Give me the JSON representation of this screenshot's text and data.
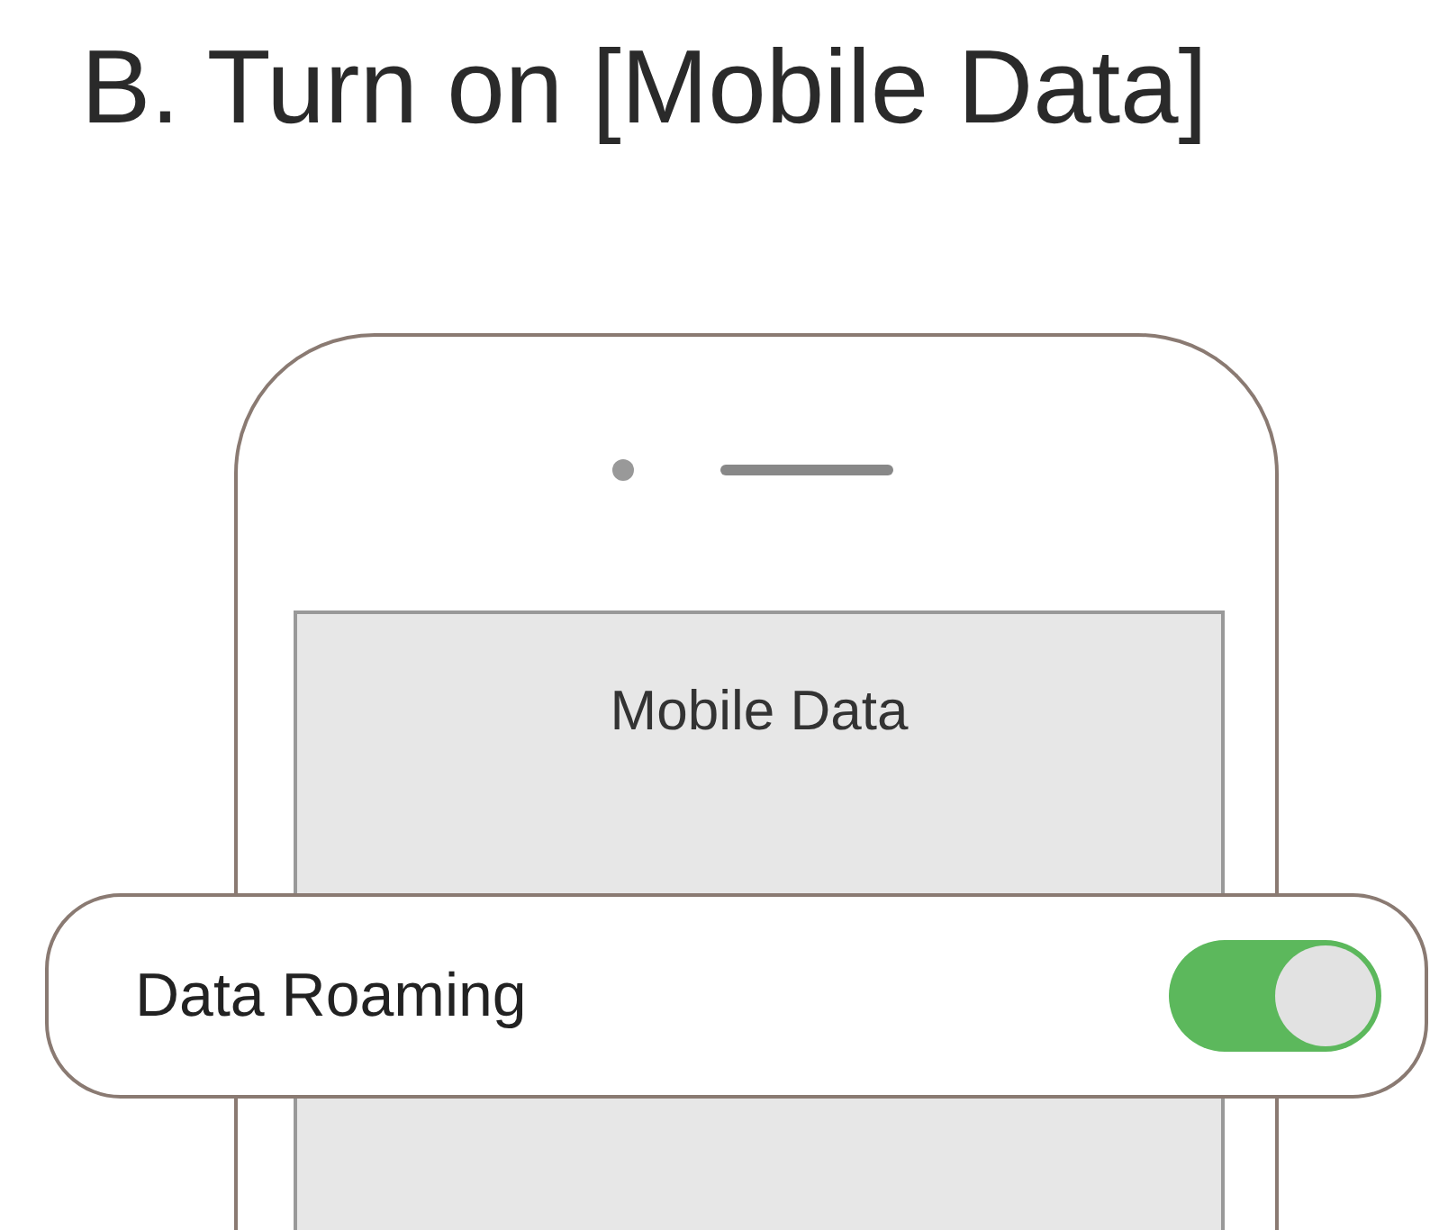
{
  "title": "B. Turn on [Mobile Data]",
  "screen": {
    "title": "Mobile Data"
  },
  "callout": {
    "label": "Data Roaming",
    "on": true
  }
}
